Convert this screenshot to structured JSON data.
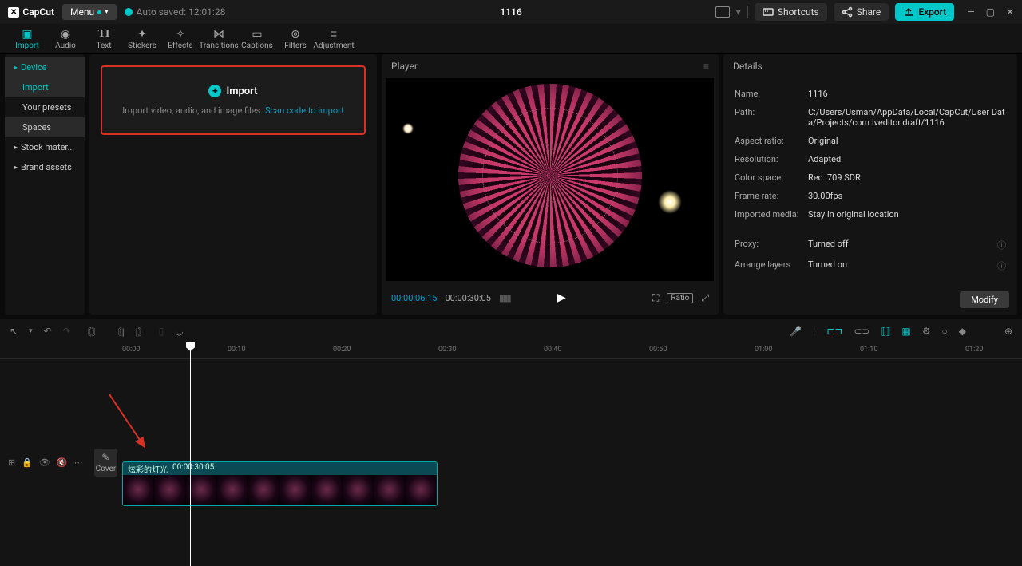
{
  "app": {
    "name": "CapCut",
    "menu": "Menu",
    "autosave": "Auto saved: 12:01:28",
    "title": "1116"
  },
  "titlebar": {
    "shortcuts": "Shortcuts",
    "share": "Share",
    "export": "Export"
  },
  "tooltabs": [
    {
      "label": "Import"
    },
    {
      "label": "Audio"
    },
    {
      "label": "Text"
    },
    {
      "label": "Stickers"
    },
    {
      "label": "Effects"
    },
    {
      "label": "Transitions"
    },
    {
      "label": "Captions"
    },
    {
      "label": "Filters"
    },
    {
      "label": "Adjustment"
    }
  ],
  "sidebar": {
    "items": [
      {
        "label": "Device",
        "expandable": true,
        "active": true
      },
      {
        "label": "Import"
      },
      {
        "label": "Your presets"
      },
      {
        "label": "Spaces"
      },
      {
        "label": "Stock mater...",
        "expandable": true
      },
      {
        "label": "Brand assets",
        "expandable": true
      }
    ]
  },
  "import": {
    "title": "Import",
    "subtitle": "Import video, audio, and image files. ",
    "link": "Scan code to import"
  },
  "player": {
    "title": "Player",
    "current": "00:00:06:15",
    "duration": "00:00:30:05",
    "ratio": "Ratio"
  },
  "details": {
    "title": "Details",
    "rows": [
      {
        "k": "Name:",
        "v": "1116"
      },
      {
        "k": "Path:",
        "v": "C:/Users/Usman/AppData/Local/CapCut/User Data/Projects/com.lveditor.draft/1116"
      },
      {
        "k": "Aspect ratio:",
        "v": "Original"
      },
      {
        "k": "Resolution:",
        "v": "Adapted"
      },
      {
        "k": "Color space:",
        "v": "Rec. 709 SDR"
      },
      {
        "k": "Frame rate:",
        "v": "30.00fps"
      },
      {
        "k": "Imported media:",
        "v": "Stay in original location"
      }
    ],
    "rows2": [
      {
        "k": "Proxy:",
        "v": "Turned off",
        "info": true
      },
      {
        "k": "Arrange layers",
        "v": "Turned on",
        "info": true
      }
    ],
    "modify": "Modify"
  },
  "timeline": {
    "ticks": [
      "00:00",
      "00:10",
      "00:20",
      "00:30",
      "00:40",
      "00:50",
      "01:00",
      "01:10",
      "01:20"
    ],
    "clip": {
      "name": "炫彩的灯光",
      "dur": "00:00:30:05"
    },
    "cover": "Cover"
  }
}
